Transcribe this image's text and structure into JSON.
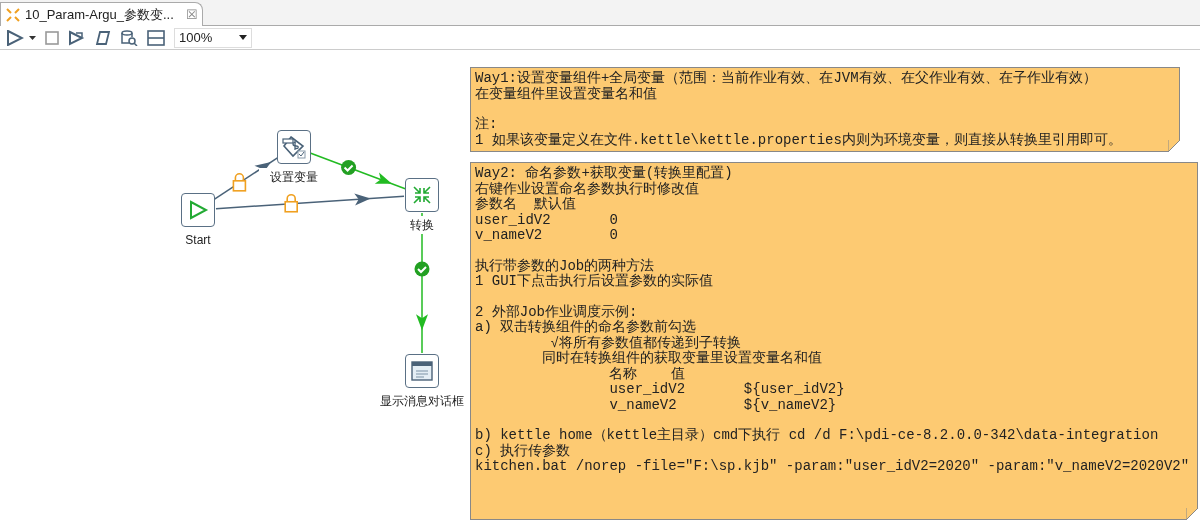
{
  "tab": {
    "title": "10_Param-Argu_参数变...",
    "close": "☒"
  },
  "toolbar": {
    "zoom": "100%"
  },
  "nodes": [
    {
      "kind": "start",
      "label": "Start"
    },
    {
      "kind": "set-variables",
      "label": "设置变量"
    },
    {
      "kind": "transformation",
      "label": "转换"
    },
    {
      "kind": "message-box",
      "label": "显示消息对话框"
    }
  ],
  "hops": [
    {
      "kind": "unconditional"
    },
    {
      "kind": "unconditional"
    },
    {
      "kind": "success"
    },
    {
      "kind": "success"
    }
  ],
  "notes": [
    {
      "paragraphs": [
        [
          "Way1:设置变量组件+全局变量（范围：当前作业有效、在JVM有效、在父作业有效、在子作业有效）",
          "在变量组件里设置变量名和值"
        ],
        [
          "注:",
          "1 如果该变量定义在文件.kettle\\kettle.properties内则为环境变量，则直接从转换里引用即可。"
        ]
      ]
    },
    {
      "paragraphs": [
        [
          "Way2: 命名参数+获取变量(转换里配置)",
          "右键作业设置命名参数执行时修改值",
          "参数名  默认值",
          "user_idV2       0",
          "v_nameV2        0"
        ],
        [
          "执行带参数的Job的两种方法",
          "1 GUI下点击执行后设置参数的实际值"
        ],
        [
          "2 外部Job作业调度示例:",
          "a) 双击转换组件的命名参数前勾选",
          "         √将所有参数值都传递到子转换",
          "        同时在转换组件的获取变量里设置变量名和值",
          "                名称    值",
          "                user_idV2       ${user_idV2}",
          "                v_nameV2        ${v_nameV2}"
        ],
        [
          "b) kettle home（kettle主目录）cmd下执行 cd /d F:\\pdi-ce-8.2.0.0-342\\data-integration",
          "c) 执行传参数",
          "kitchen.bat /norep -file=\"F:\\sp.kjb\" -param:\"user_idV2=2020\" -param:\"v_nameV2=2020V2\""
        ]
      ]
    }
  ]
}
